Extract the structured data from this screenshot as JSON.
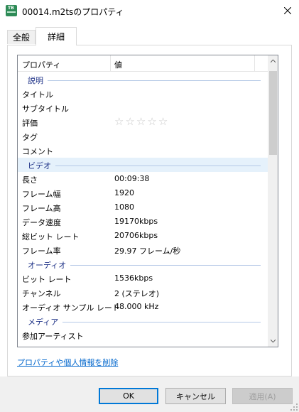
{
  "window": {
    "title": "00014.m2tsのプロパティ",
    "icon": "video-file-icon",
    "close_glyph": "✕"
  },
  "tabs": [
    {
      "label": "全般",
      "active": false
    },
    {
      "label": "詳細",
      "active": true
    }
  ],
  "list": {
    "columns": {
      "name": "プロパティ",
      "value": "値"
    },
    "sections": [
      {
        "group": "説明",
        "selected": false,
        "rows": [
          {
            "name": "タイトル",
            "value": ""
          },
          {
            "name": "サブタイトル",
            "value": ""
          },
          {
            "name": "評価",
            "value": "",
            "rating": 0,
            "max_rating": 5
          },
          {
            "name": "タグ",
            "value": ""
          },
          {
            "name": "コメント",
            "value": ""
          }
        ]
      },
      {
        "group": "ビデオ",
        "selected": true,
        "rows": [
          {
            "name": "長さ",
            "value": "00:09:38"
          },
          {
            "name": "フレーム幅",
            "value": "1920"
          },
          {
            "name": "フレーム高",
            "value": "1080"
          },
          {
            "name": "データ速度",
            "value": "19170kbps"
          },
          {
            "name": "総ビット レート",
            "value": "20706kbps"
          },
          {
            "name": "フレーム率",
            "value": "29.97 フレーム/秒"
          }
        ]
      },
      {
        "group": "オーディオ",
        "selected": false,
        "rows": [
          {
            "name": "ビット レート",
            "value": "1536kbps"
          },
          {
            "name": "チャンネル",
            "value": "2 (ステレオ)"
          },
          {
            "name": "オーディオ サンプル レート",
            "value": "48.000 kHz"
          }
        ]
      },
      {
        "group": "メディア",
        "selected": false,
        "rows": [
          {
            "name": "参加アーティスト",
            "value": ""
          }
        ]
      }
    ]
  },
  "remove_link": "プロパティや個人情報を削除",
  "buttons": {
    "ok": "OK",
    "cancel": "キャンセル",
    "apply": "適用(A)",
    "apply_enabled": false
  },
  "colors": {
    "group_text": "#1e3287",
    "link": "#0066cc",
    "selection": "#e5f1fb",
    "focus_border": "#0078d7"
  }
}
